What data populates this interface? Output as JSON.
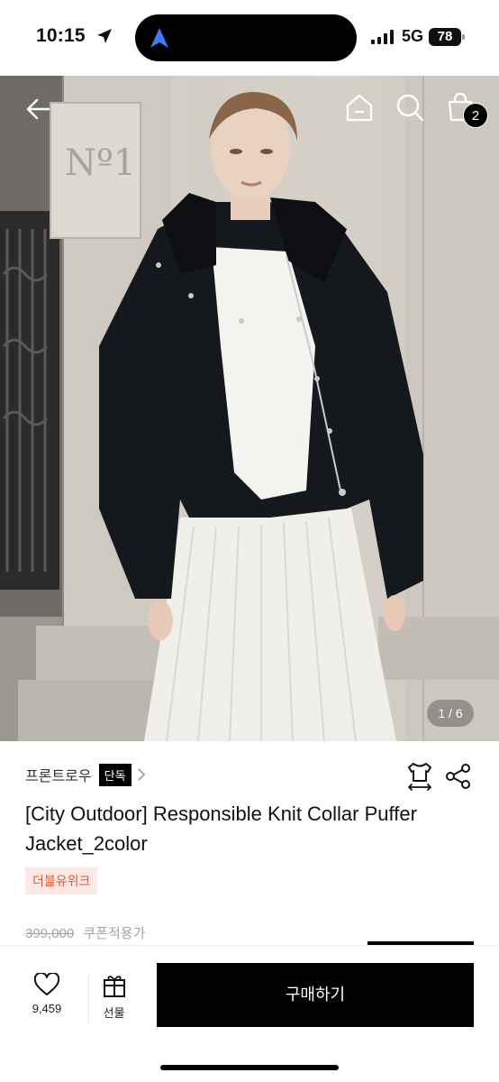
{
  "status_bar": {
    "time": "10:15",
    "network": "5G",
    "battery": "78"
  },
  "hero": {
    "pager": "1 / 6",
    "cart_count": "2",
    "background_sign": "Nº1"
  },
  "product": {
    "brand": "프론트로우",
    "exclusive_badge": "단독",
    "title": "[City Outdoor] Responsible Knit Collar Puffer Jacket_2color",
    "tag": "더블유위크",
    "original_price": "399,000",
    "coupon_label": "쿠폰적용가"
  },
  "bottom_bar": {
    "like_count": "9,459",
    "gift_label": "선물",
    "buy_label": "구매하기"
  },
  "colors": {
    "tag_bg": "#fde9e6",
    "tag_text": "#e2552d",
    "primary": "#000000"
  }
}
